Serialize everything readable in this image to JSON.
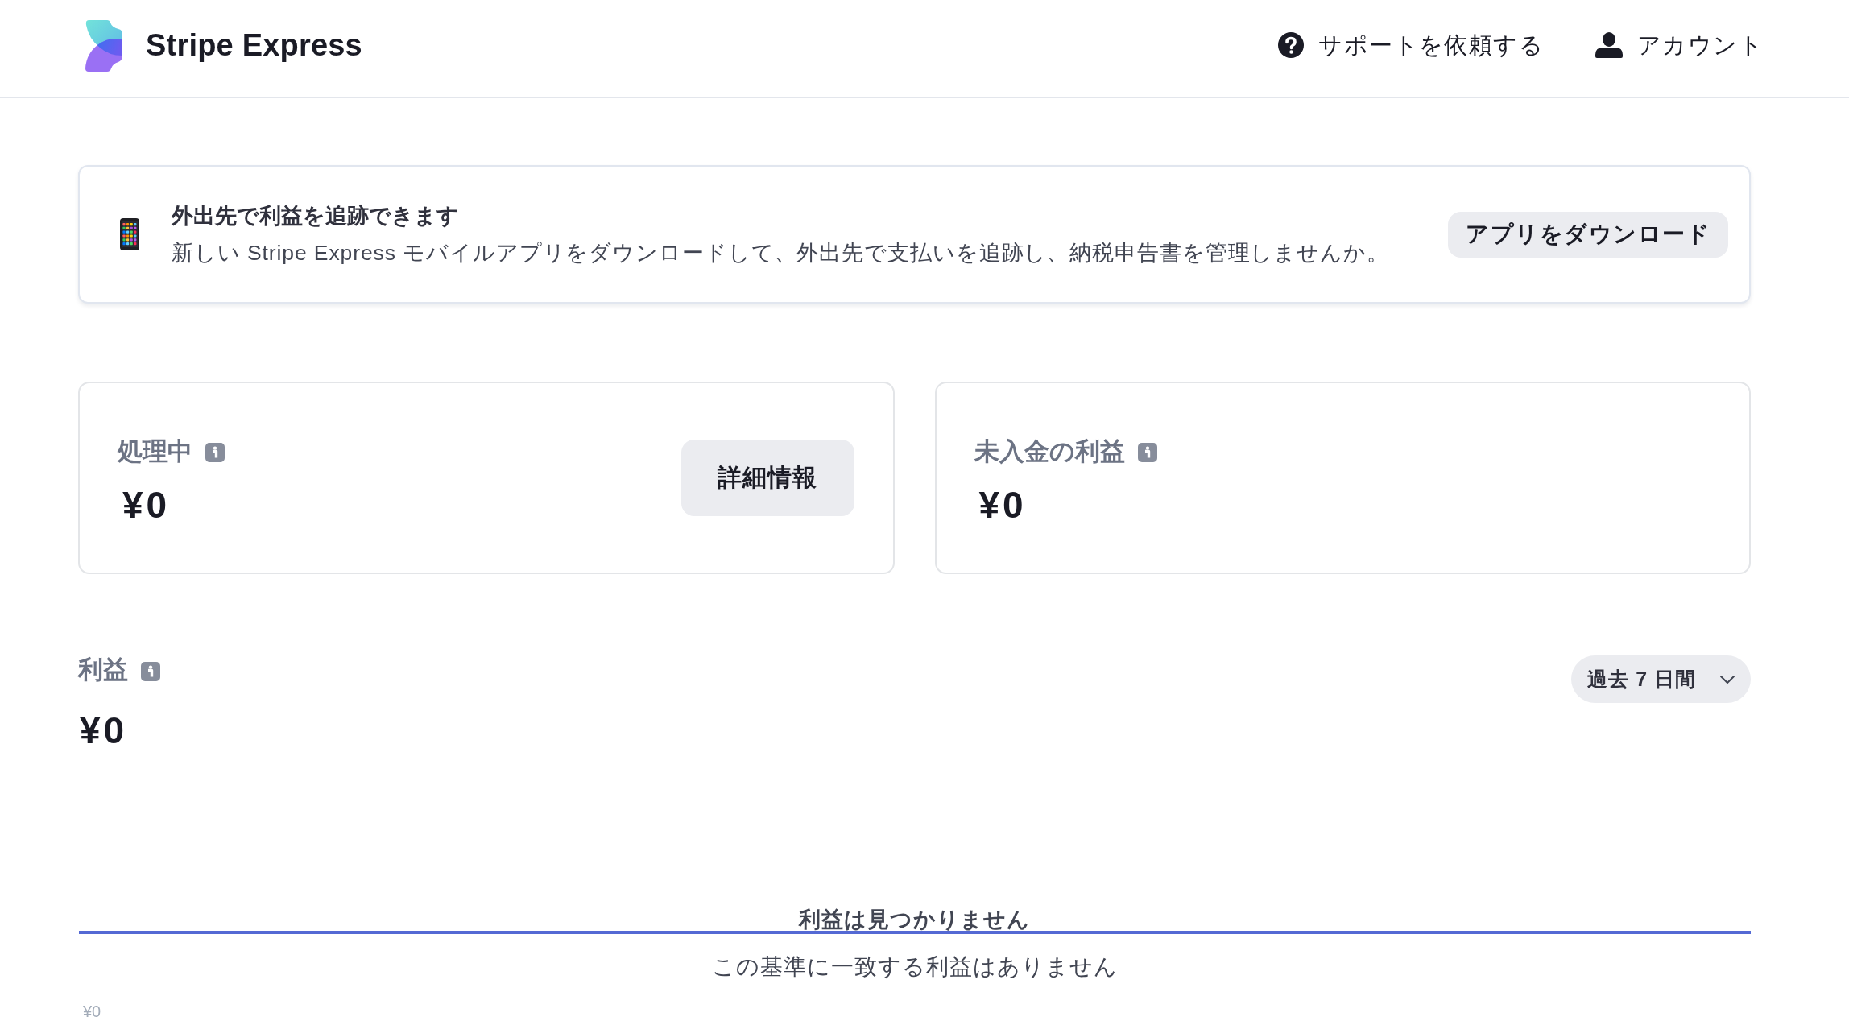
{
  "header": {
    "brand": "Stripe Express",
    "links": [
      {
        "kind": "help",
        "label": "サポートを依頼する"
      },
      {
        "kind": "account",
        "label": "アカウント"
      }
    ]
  },
  "banner": {
    "title": "外出先で利益を追跡できます",
    "description": "新しい Stripe Express モバイルアプリをダウンロードして、外出先で支払いを追跡し、納税申告書を管理しませんか。",
    "button": "アプリをダウンロード"
  },
  "balances": [
    {
      "label": "処理中",
      "amount": "¥0",
      "button": "詳細情報"
    },
    {
      "label": "未入金の利益",
      "amount": "¥0"
    }
  ],
  "earnings": {
    "label": "利益",
    "amount": "¥0",
    "period": "過去 7 日間",
    "chart": {
      "empty_title": "利益は見つかりません",
      "empty_message": "この基準に一致する利益はありません",
      "axis_label": "¥0"
    }
  }
}
